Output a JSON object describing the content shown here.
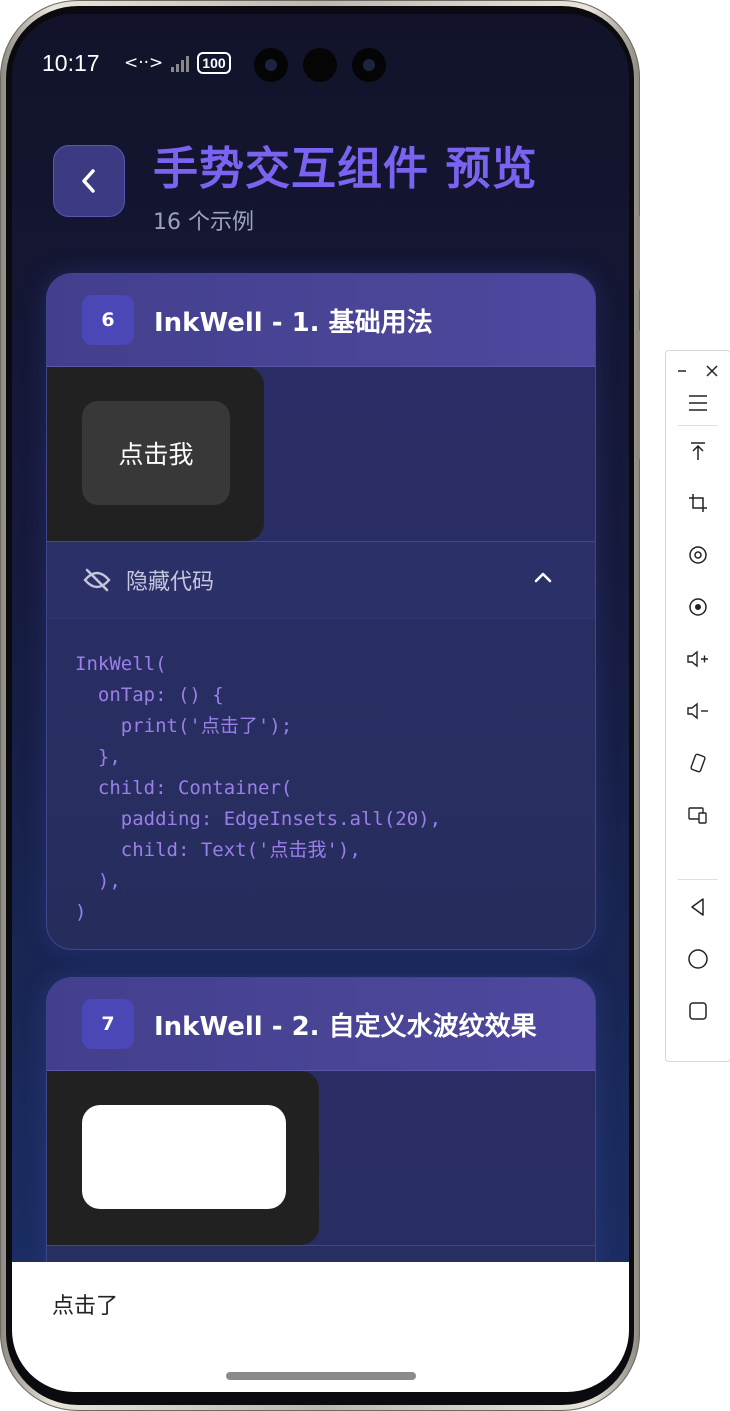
{
  "status_bar": {
    "time": "10:17",
    "data_indicator": "<··>",
    "battery": "100"
  },
  "header": {
    "title": "手势交互组件 预览",
    "subtitle": "16 个示例"
  },
  "cards": [
    {
      "index": "6",
      "title": "InkWell - 1. 基础用法",
      "preview_button_label": "点击我",
      "code_toggle_label": "隐藏代码",
      "code_lines": [
        "InkWell(",
        "  onTap: () {",
        "    print('点击了');",
        "  },",
        "  child: Container(",
        "    padding: EdgeInsets.all(20),",
        "    child: Text('点击我'),",
        "  ),",
        ")"
      ]
    },
    {
      "index": "7",
      "title": "InkWell - 2. 自定义水波纹效果"
    }
  ],
  "snackbar": {
    "message": "点击了"
  },
  "toolbar": {
    "items": [
      "minimize-icon",
      "close-icon",
      "menu-icon",
      "pin-top-icon",
      "crop-icon",
      "rotate-icon",
      "screen-record-icon",
      "volume-up-icon",
      "volume-down-icon",
      "rotate-device-icon",
      "multi-device-icon",
      "nav-back-icon",
      "nav-home-icon",
      "nav-recents-icon"
    ]
  },
  "colors": {
    "title_accent": "#7a63f0",
    "code_text": "#9b7fe9",
    "index_badge": "#4b47b6"
  }
}
